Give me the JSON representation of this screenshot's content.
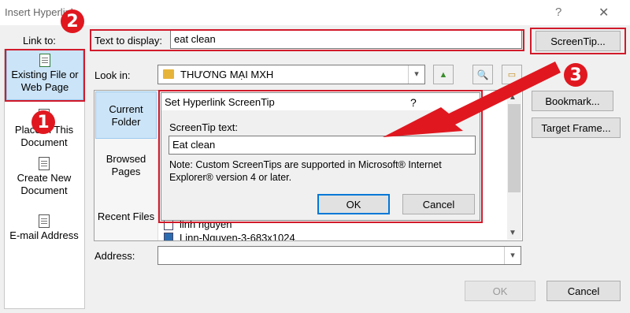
{
  "window": {
    "title": "Insert Hyperlink",
    "help_glyph": "?",
    "close_glyph": "✕"
  },
  "link_to": {
    "label": "Link to:",
    "items": [
      {
        "label": "Existing File or Web Page",
        "icon": "web-page-icon"
      },
      {
        "label": "Place in This Document",
        "icon": "document-place-icon"
      },
      {
        "label": "Create New Document",
        "icon": "new-document-icon"
      },
      {
        "label": "E-mail Address",
        "icon": "email-icon"
      }
    ]
  },
  "text_to_display": {
    "label": "Text to display:",
    "value": "eat clean"
  },
  "screentip_button": "ScreenTip...",
  "look_in": {
    "label": "Look in:",
    "value": "THƯƠNG MẠI MXH"
  },
  "browse_panel": {
    "items": [
      {
        "label": "Current Folder"
      },
      {
        "label": "Browsed Pages"
      },
      {
        "label": "Recent Files"
      }
    ],
    "files": [
      "linh nguyen",
      "Linn-Nguyen-3-683x1024"
    ]
  },
  "side_buttons": {
    "bookmark": "Bookmark...",
    "target_frame": "Target Frame..."
  },
  "address": {
    "label": "Address:",
    "value": ""
  },
  "footer": {
    "ok": "OK",
    "cancel": "Cancel"
  },
  "screentip_dialog": {
    "title": "Set Hyperlink ScreenTip",
    "help_glyph": "?",
    "field_label": "ScreenTip text:",
    "field_value": "Eat clean",
    "note_line1": "Note: Custom ScreenTips are supported in Microsoft® Internet",
    "note_line2": "Explorer® version 4 or later.",
    "ok": "OK",
    "cancel": "Cancel"
  },
  "callouts": {
    "one": "1",
    "two": "2",
    "three": "3"
  },
  "colors": {
    "accent_red": "#d11a2a",
    "selected_blue": "#cce4f7",
    "dialog_bg": "#f0f0f0"
  }
}
